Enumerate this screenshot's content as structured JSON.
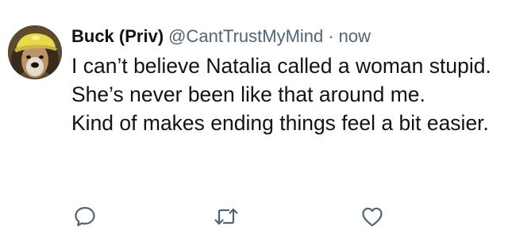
{
  "tweet": {
    "display_name": "Buck (Priv)",
    "handle": "@CantTrustMyMind",
    "separator": "·",
    "timestamp": "now",
    "body_lines": [
      "I can’t believe Natalia called a woman stupid. She’s never been like that around me.",
      "Kind of makes ending things feel a bit easier."
    ]
  },
  "actions": {
    "reply_icon": "speech-bubble-icon",
    "retweet_icon": "retweet-arrows-icon",
    "like_icon": "heart-outline-icon"
  },
  "colors": {
    "text": "#0f1419",
    "secondary": "#536471",
    "avatar_hat": "#e8d84a"
  }
}
